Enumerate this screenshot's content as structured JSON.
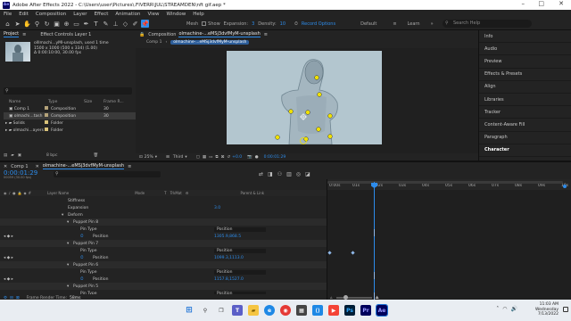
{
  "window": {
    "title": "Adobe After Effects 2022 - C:\\Users\\user\\Pictures\\.FIVERR\\JUL\\STREAMDEN\\nft gif.aep *",
    "app_badge": "Ae"
  },
  "menu": [
    "File",
    "Edit",
    "Composition",
    "Layer",
    "Effect",
    "Animation",
    "View",
    "Window",
    "Help"
  ],
  "toolbar": {
    "mesh_label": "Mesh",
    "show_label": "Show",
    "expansion_label": "Expansion:",
    "expansion_value": "3",
    "density_label": "Density:",
    "density_value": "10",
    "record_options": "Record Options",
    "default": "Default",
    "learn": "Learn",
    "search_placeholder": "Search Help"
  },
  "project": {
    "tab": "Project",
    "effect_controls_tab": "Effect Controls Layer 1",
    "selected_name": "olllmachi...yMl-unsplash",
    "used": "used 1 time",
    "dims": "1500 x 1000 (500 x 334) (1.00)",
    "duration": "Δ 0:00:10:00, 30.00 fps",
    "columns": [
      "Name",
      "Type",
      "Size",
      "Frame R..."
    ],
    "rows": [
      {
        "name": "Comp 1",
        "type": "Composition",
        "size": "",
        "fps": "30",
        "color": "#b5a37a"
      },
      {
        "name": "olmachi...tash",
        "type": "Composition",
        "size": "",
        "fps": "30",
        "color": "#b5a37a"
      },
      {
        "name": "Solids",
        "type": "Folder",
        "size": "",
        "fps": "",
        "color": "#d8c27a"
      },
      {
        "name": "olmachi...ayers",
        "type": "Folder",
        "size": "",
        "fps": "",
        "color": "#d8c27a"
      }
    ],
    "bpc": "8 bpc"
  },
  "composition": {
    "tab_label": "Composition",
    "tab_name": "olmachine-...eMSj3dvfMyM-unsplash",
    "crumb1": "Comp 1",
    "crumb2": "olmachine-...eMSj3dvfMyM-unsplash",
    "zoom": "25%",
    "quality": "Third",
    "exposure": "+0.0",
    "timecode": "0:00:01:29"
  },
  "right_panel": {
    "items": [
      "Info",
      "Audio",
      "Preview",
      "Effects & Presets",
      "Align",
      "Libraries",
      "Tracker",
      "Content-Aware Fill",
      "Paragraph",
      "Character"
    ]
  },
  "timeline": {
    "tabs": [
      "Comp 1",
      "olmachine-...eMSj3dvfMyM-unsplash"
    ],
    "timecode": "0:00:01:29",
    "timecode_sub": "00059 (30.00 fps)",
    "columns": {
      "layer_name": "Layer Name",
      "mode": "Mode",
      "t": "T",
      "trkmat": "TrkMat",
      "parent": "Parent & Link"
    },
    "ruler": [
      "0:00s",
      "01s",
      "02s",
      "03s",
      "04s",
      "05s",
      "06s",
      "07s",
      "08s",
      "09s",
      "10s"
    ],
    "rows": [
      {
        "label": "Stiffness",
        "indent": 76,
        "value": "",
        "group": false
      },
      {
        "label": "Expansion",
        "indent": 76,
        "value": "3.0",
        "group": false
      },
      {
        "label": "Deform",
        "indent": 76,
        "value": "",
        "group": false
      },
      {
        "label": "Puppet Pin 8",
        "indent": 82,
        "value": "",
        "group": true
      },
      {
        "label": "Pin Type",
        "indent": 90,
        "value": "Position",
        "group": false
      },
      {
        "label": "Position",
        "indent": 104,
        "value": "1305.9,868.5",
        "group": false
      },
      {
        "label": "Puppet Pin 7",
        "indent": 82,
        "value": "",
        "group": true
      },
      {
        "label": "Pin Type",
        "indent": 90,
        "value": "Position",
        "group": false
      },
      {
        "label": "Position",
        "indent": 104,
        "value": "1099.3,1113.0",
        "group": false
      },
      {
        "label": "Puppet Pin 6",
        "indent": 82,
        "value": "",
        "group": true
      },
      {
        "label": "Pin Type",
        "indent": 90,
        "value": "Position",
        "group": false
      },
      {
        "label": "Position",
        "indent": 104,
        "value": "1157.8,1527.0",
        "group": false
      },
      {
        "label": "Puppet Pin 5",
        "indent": 82,
        "value": "",
        "group": true
      },
      {
        "label": "Pin Type",
        "indent": 90,
        "value": "Position",
        "group": false
      }
    ],
    "frame_render_label": "Frame Render Time:",
    "frame_render_value": "58ms",
    "toggle": "Toggle Switches / Modes"
  },
  "taskbar": {
    "time": "11:03 AM",
    "day": "Wednesday",
    "date": "7/13/2022"
  }
}
